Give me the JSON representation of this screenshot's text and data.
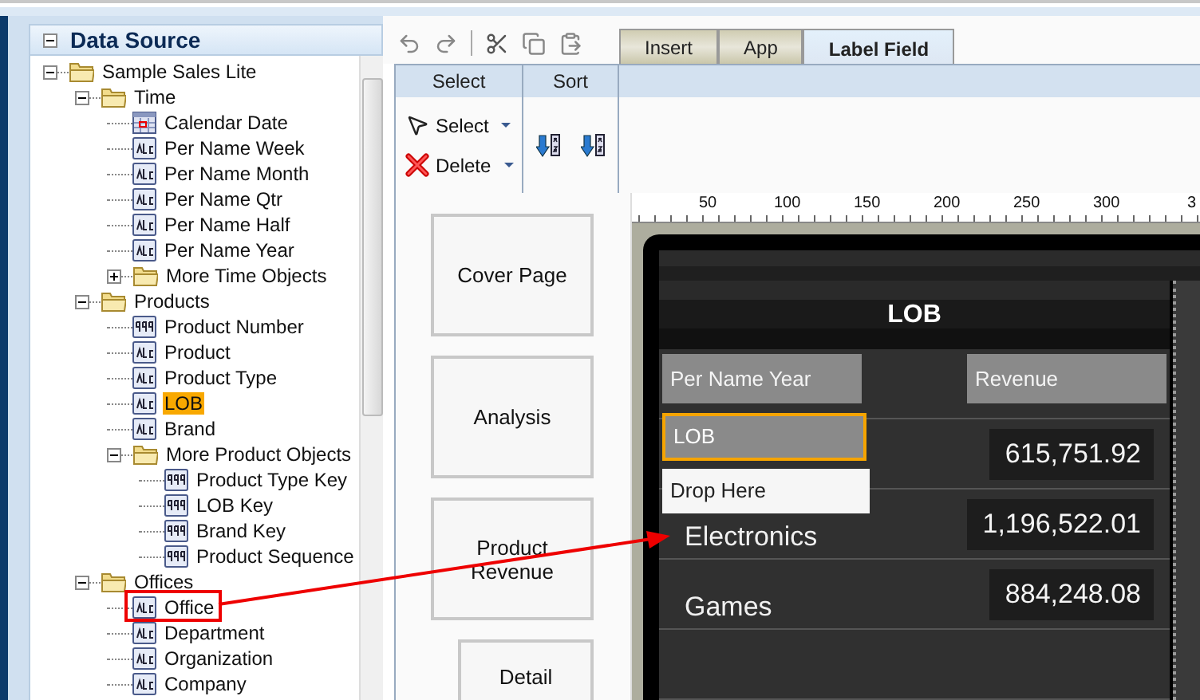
{
  "data_source": {
    "title": "Data Source",
    "tree": [
      {
        "label": "Sample Sales Lite",
        "kind": "folder",
        "expanded": true,
        "selected": false,
        "children": [
          {
            "label": "Time",
            "kind": "folder",
            "expanded": true,
            "selected": false,
            "children": [
              {
                "label": "Calendar Date",
                "kind": "date",
                "selected": false
              },
              {
                "label": "Per Name Week",
                "kind": "text",
                "selected": false
              },
              {
                "label": "Per Name Month",
                "kind": "text",
                "selected": false
              },
              {
                "label": "Per Name Qtr",
                "kind": "text",
                "selected": false
              },
              {
                "label": "Per Name Half",
                "kind": "text",
                "selected": false
              },
              {
                "label": "Per Name Year",
                "kind": "text",
                "selected": false
              },
              {
                "label": "More Time Objects",
                "kind": "folder",
                "expanded": false,
                "selected": false
              }
            ]
          },
          {
            "label": "Products",
            "kind": "folder",
            "expanded": true,
            "selected": false,
            "children": [
              {
                "label": "Product Number",
                "kind": "number",
                "selected": false
              },
              {
                "label": "Product",
                "kind": "text",
                "selected": false
              },
              {
                "label": "Product Type",
                "kind": "text",
                "selected": false
              },
              {
                "label": "LOB",
                "kind": "text",
                "selected": true
              },
              {
                "label": "Brand",
                "kind": "text",
                "selected": false
              },
              {
                "label": "More Product Objects",
                "kind": "folder",
                "expanded": true,
                "selected": false,
                "children": [
                  {
                    "label": "Product Type Key",
                    "kind": "number",
                    "selected": false
                  },
                  {
                    "label": "LOB Key",
                    "kind": "number",
                    "selected": false
                  },
                  {
                    "label": "Brand Key",
                    "kind": "number",
                    "selected": false
                  },
                  {
                    "label": "Product Sequence",
                    "kind": "number",
                    "selected": false
                  }
                ]
              }
            ]
          },
          {
            "label": "Offices",
            "kind": "folder",
            "expanded": true,
            "selected": false,
            "children": [
              {
                "label": "Office",
                "kind": "text",
                "selected": false
              },
              {
                "label": "Department",
                "kind": "text",
                "selected": false
              },
              {
                "label": "Organization",
                "kind": "text",
                "selected": false
              },
              {
                "label": "Company",
                "kind": "text",
                "selected": false
              }
            ]
          }
        ]
      }
    ]
  },
  "tabs": [
    {
      "label": "Insert",
      "selected": false
    },
    {
      "label": "App",
      "selected": false
    },
    {
      "label": "Label Field",
      "selected": true
    }
  ],
  "ribbon": {
    "groups": [
      {
        "title": "Select",
        "buttons": [
          {
            "label": "Select",
            "kind": "pointer"
          },
          {
            "label": "Delete",
            "kind": "delete"
          }
        ]
      },
      {
        "title": "Sort",
        "buttons": [
          {
            "kind": "sort-ascending"
          },
          {
            "kind": "sort-descending"
          }
        ]
      }
    ]
  },
  "pages": [
    "Cover Page",
    "Analysis",
    "Product Revenue",
    "Detail"
  ],
  "ruler": [
    "50",
    "100",
    "150",
    "200",
    "250",
    "300",
    "3"
  ],
  "report": {
    "title": "LOB",
    "columns": [
      "Per Name Year",
      "Revenue"
    ],
    "rows": [
      {
        "value": "615,751.92"
      },
      {
        "label": "Electronics",
        "value": "1,196,522.01"
      },
      {
        "label": "Games",
        "value": "884,248.08"
      }
    ]
  },
  "drag": {
    "label": "LOB",
    "drop_hint": "Drop Here"
  }
}
